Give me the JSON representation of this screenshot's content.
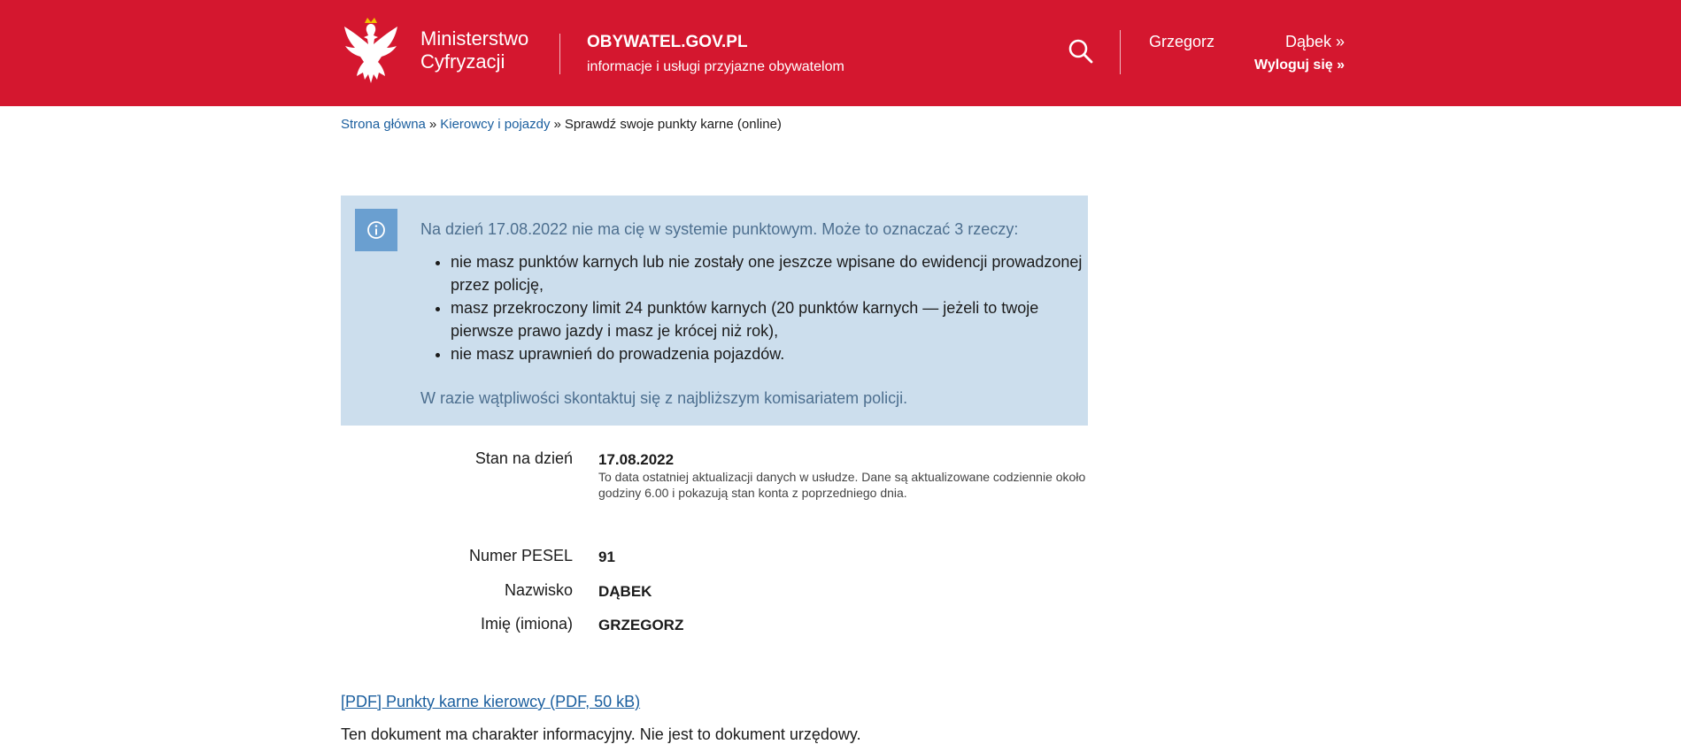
{
  "header": {
    "ministry_line1": "Ministerstwo",
    "ministry_line2": "Cyfryzacji",
    "site_name": "OBYWATEL.GOV.PL",
    "site_tagline": "informacje i usługi przyjazne obywatelom",
    "user_first_name": "Grzegorz",
    "user_last_name": "Dąbek »",
    "logout_label": "Wyloguj się »",
    "accent_color": "#d4172f"
  },
  "breadcrumb": {
    "items": [
      "Strona główna",
      "Kierowcy i pojazdy"
    ],
    "current": "Sprawdź swoje punkty karne (online)",
    "separator": "»"
  },
  "info_box": {
    "intro": "Na dzień 17.08.2022 nie ma cię w systemie punktowym. Może to oznaczać 3 rzeczy:",
    "items": [
      "nie masz punktów karnych lub nie zostały one jeszcze wpisane do ewidencji prowadzonej przez policję,",
      "masz przekroczony limit 24 punktów karnych (20 punktów karnych — jeżeli to twoje pierwsze prawo jazdy i masz je krócej niż rok),",
      "nie masz uprawnień do prowadzenia pojazdów."
    ],
    "outro": "W razie wątpliwości skontaktuj się z najbliższym komisariatem policji."
  },
  "details": {
    "date_label": "Stan na dzień",
    "date_value": "17.08.2022",
    "date_note": "To data ostatniej aktualizacji danych w usłudze. Dane są aktualizowane codziennie około godziny 6.00 i pokazują stan konta z poprzedniego dnia.",
    "pesel_label": "Numer PESEL",
    "pesel_value": "91",
    "surname_label": "Nazwisko",
    "surname_value": "DĄBEK",
    "firstname_label": "Imię (imiona)",
    "firstname_value": "GRZEGORZ"
  },
  "pdf_link_label": "[PDF] Punkty karne kierowcy (PDF, 50 kB)",
  "footnote": "Ten dokument ma charakter informacyjny. Nie jest to dokument urzędowy."
}
